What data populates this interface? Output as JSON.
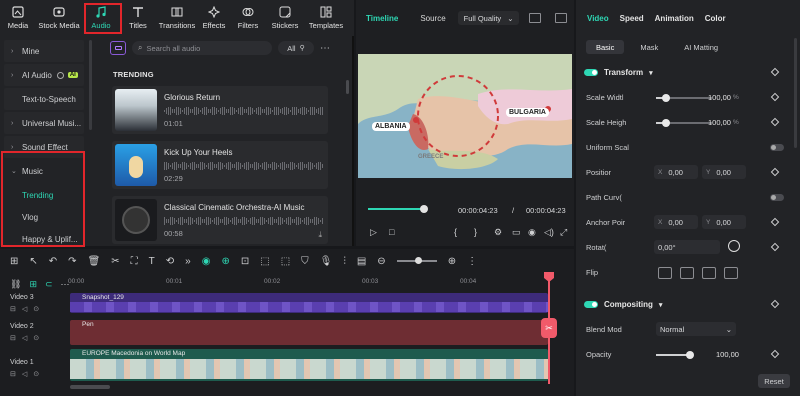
{
  "top_tabs": [
    {
      "label": "Media",
      "icon": "media-icon"
    },
    {
      "label": "Stock Media",
      "icon": "stock-media-icon"
    },
    {
      "label": "Audio",
      "icon": "music-note-icon"
    },
    {
      "label": "Titles",
      "icon": "titles-icon"
    },
    {
      "label": "Transitions",
      "icon": "transitions-icon"
    },
    {
      "label": "Effects",
      "icon": "effects-icon"
    },
    {
      "label": "Filters",
      "icon": "filters-icon"
    },
    {
      "label": "Stickers",
      "icon": "stickers-icon"
    },
    {
      "label": "Templates",
      "icon": "templates-icon"
    }
  ],
  "sidebar": {
    "items": [
      {
        "label": "Mine"
      },
      {
        "label": "AI Audio",
        "badge": "AI"
      },
      {
        "label": "Text-to-Speech"
      },
      {
        "label": "Universal Musi..."
      },
      {
        "label": "Sound Effect"
      },
      {
        "label": "Music"
      }
    ],
    "music_subitems": [
      "Trending",
      "Vlog",
      "Happy & Uplif..."
    ]
  },
  "audio": {
    "search_placeholder": "Search all audio",
    "filter_label": "All",
    "section_title": "TRENDING",
    "tracks": [
      {
        "title": "Glorious Return",
        "duration": "01:01"
      },
      {
        "title": "Kick Up Your Heels",
        "duration": "02:29"
      },
      {
        "title": "Classical Cinematic Orchestra-AI Music",
        "duration": "00:58"
      }
    ]
  },
  "preview": {
    "tabs": [
      "Timeline",
      "Source"
    ],
    "quality": "Full Quality",
    "map_labels": [
      "ALBANIA",
      "BULGARIA",
      "GREECE"
    ],
    "current_time": "00:00:04:23",
    "separator": "/",
    "total_time": "00:00:04:23",
    "playback_progress": 1.0
  },
  "timeline": {
    "ruler": [
      "00:00",
      "00:01",
      "00:02",
      "00:03",
      "00:04"
    ],
    "tracks": [
      {
        "name": "Video 3",
        "clip": "Snapshot_129"
      },
      {
        "name": "Video 2",
        "clip": "Pen"
      },
      {
        "name": "Video 1",
        "clip": "EUROPE Macedonia on World Map"
      }
    ]
  },
  "properties": {
    "tabs": [
      "Video",
      "Speed",
      "Animation",
      "Color"
    ],
    "sub_tabs": [
      "Basic",
      "Mask",
      "AI Matting"
    ],
    "transform_title": "Transform",
    "scale_width": {
      "label": "Scale Widtl",
      "value": "100,00",
      "unit": "%"
    },
    "scale_height": {
      "label": "Scale Heigh",
      "value": "100,00",
      "unit": "%"
    },
    "uniform_scale": {
      "label": "Uniform Scal"
    },
    "position": {
      "label": "Positior",
      "x": "0,00",
      "y": "0,00"
    },
    "path_curve": {
      "label": "Path Curv("
    },
    "anchor_point": {
      "label": "Anchor Poir",
      "x": "0,00",
      "y": "0,00"
    },
    "rotate": {
      "label": "Rotat(",
      "value": "0,00°"
    },
    "flip": {
      "label": "Flip"
    },
    "compositing_title": "Compositing",
    "blend_mode": {
      "label": "Blend Mod",
      "value": "Normal"
    },
    "opacity": {
      "label": "Opacity",
      "value": "100,00"
    },
    "reset_label": "Reset"
  },
  "colors": {
    "accent": "#2ed7b4",
    "highlight": "#e2262b",
    "playhead": "#f15a6a"
  }
}
